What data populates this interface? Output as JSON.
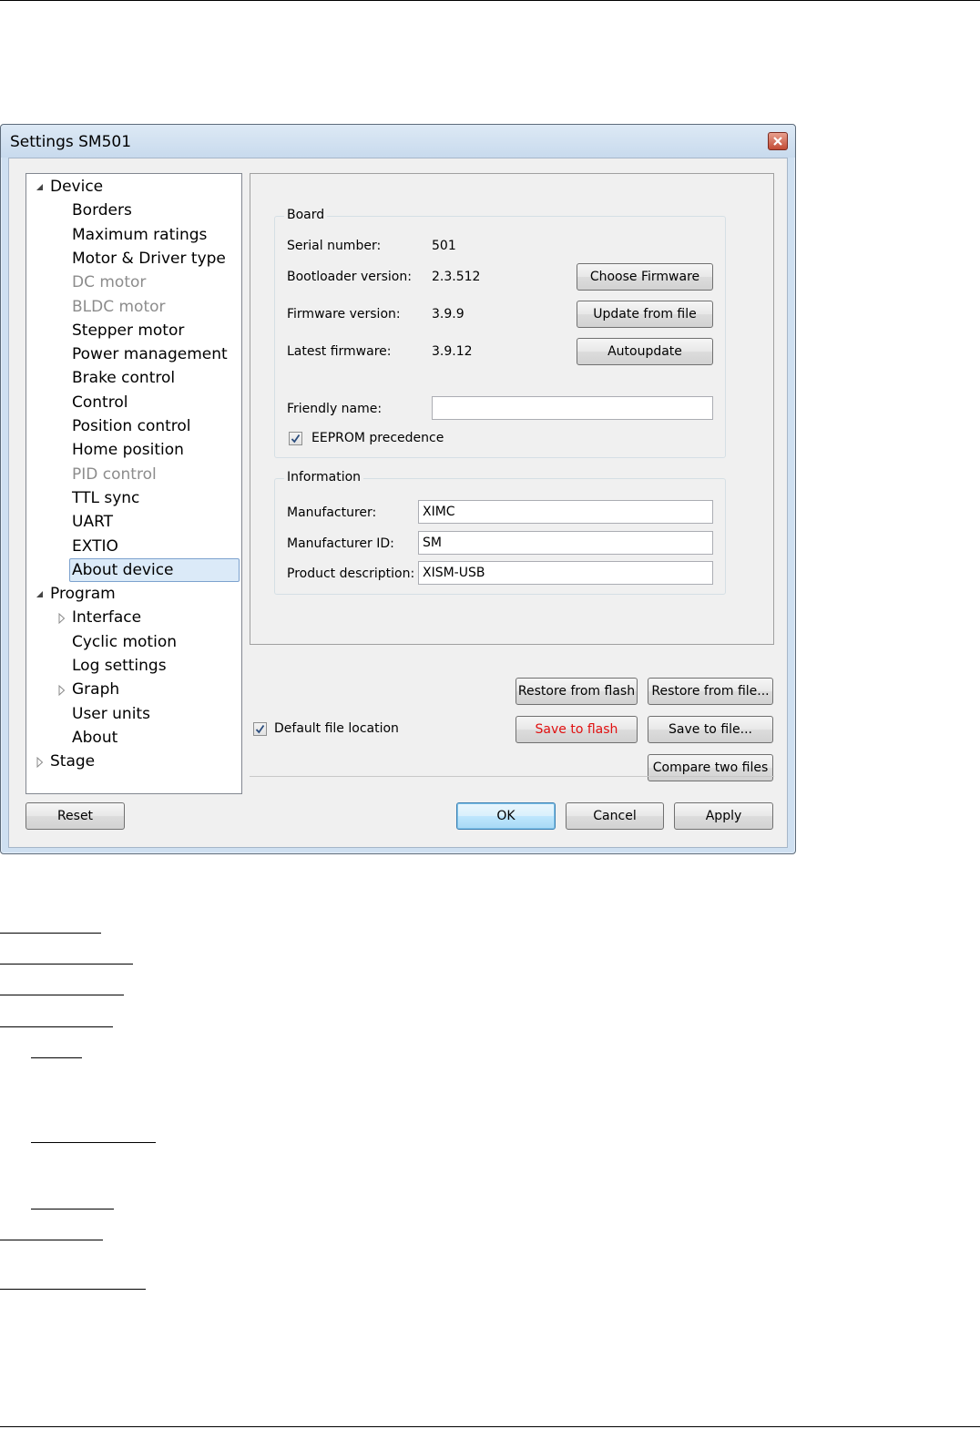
{
  "window": {
    "title": "Settings SM501"
  },
  "tree": {
    "items": [
      {
        "label": "Device",
        "level": 0,
        "expander": "expanded",
        "disabled": false,
        "selected": false
      },
      {
        "label": "Borders",
        "level": 1,
        "expander": "none",
        "disabled": false,
        "selected": false
      },
      {
        "label": "Maximum ratings",
        "level": 1,
        "expander": "none",
        "disabled": false,
        "selected": false
      },
      {
        "label": "Motor & Driver type",
        "level": 1,
        "expander": "none",
        "disabled": false,
        "selected": false
      },
      {
        "label": "DC motor",
        "level": 1,
        "expander": "none",
        "disabled": true,
        "selected": false
      },
      {
        "label": "BLDC motor",
        "level": 1,
        "expander": "none",
        "disabled": true,
        "selected": false
      },
      {
        "label": "Stepper motor",
        "level": 1,
        "expander": "none",
        "disabled": false,
        "selected": false
      },
      {
        "label": "Power management",
        "level": 1,
        "expander": "none",
        "disabled": false,
        "selected": false
      },
      {
        "label": "Brake control",
        "level": 1,
        "expander": "none",
        "disabled": false,
        "selected": false
      },
      {
        "label": "Control",
        "level": 1,
        "expander": "none",
        "disabled": false,
        "selected": false
      },
      {
        "label": "Position control",
        "level": 1,
        "expander": "none",
        "disabled": false,
        "selected": false
      },
      {
        "label": "Home position",
        "level": 1,
        "expander": "none",
        "disabled": false,
        "selected": false
      },
      {
        "label": "PID control",
        "level": 1,
        "expander": "none",
        "disabled": true,
        "selected": false
      },
      {
        "label": "TTL sync",
        "level": 1,
        "expander": "none",
        "disabled": false,
        "selected": false
      },
      {
        "label": "UART",
        "level": 1,
        "expander": "none",
        "disabled": false,
        "selected": false
      },
      {
        "label": "EXTIO",
        "level": 1,
        "expander": "none",
        "disabled": false,
        "selected": false
      },
      {
        "label": "About device",
        "level": 1,
        "expander": "none",
        "disabled": false,
        "selected": true
      },
      {
        "label": "Program",
        "level": 0,
        "expander": "expanded",
        "disabled": false,
        "selected": false
      },
      {
        "label": "Interface",
        "level": 1,
        "expander": "collapsed",
        "disabled": false,
        "selected": false
      },
      {
        "label": "Cyclic motion",
        "level": 1,
        "expander": "none",
        "disabled": false,
        "selected": false
      },
      {
        "label": "Log settings",
        "level": 1,
        "expander": "none",
        "disabled": false,
        "selected": false
      },
      {
        "label": "Graph",
        "level": 1,
        "expander": "collapsed",
        "disabled": false,
        "selected": false
      },
      {
        "label": "User units",
        "level": 1,
        "expander": "none",
        "disabled": false,
        "selected": false
      },
      {
        "label": "About",
        "level": 1,
        "expander": "none",
        "disabled": false,
        "selected": false
      },
      {
        "label": "Stage",
        "level": 0,
        "expander": "collapsed",
        "disabled": false,
        "selected": false
      }
    ]
  },
  "board": {
    "title": "Board",
    "serial_label": "Serial number:",
    "serial_value": "501",
    "bootloader_label": "Bootloader version:",
    "bootloader_value": "2.3.512",
    "firmware_label": "Firmware version:",
    "firmware_value": "3.9.9",
    "latest_label": "Latest firmware:",
    "latest_value": "3.9.12",
    "choose_firmware": "Choose Firmware",
    "update_from_file": "Update from file",
    "autoupdate": "Autoupdate",
    "friendly_label": "Friendly name:",
    "friendly_value": "",
    "eeprom_label": "EEPROM precedence",
    "eeprom_checked": true
  },
  "information": {
    "title": "Information",
    "manufacturer_label": "Manufacturer:",
    "manufacturer_value": "XIMC",
    "manufacturer_id_label": "Manufacturer ID:",
    "manufacturer_id_value": "SM",
    "product_label": "Product description:",
    "product_value": "XISM-USB"
  },
  "actions": {
    "restore_flash": "Restore from flash",
    "restore_file": "Restore from file...",
    "save_flash": "Save to flash",
    "save_file": "Save to file...",
    "compare": "Compare two files",
    "default_location_label": "Default file location",
    "default_location_checked": true
  },
  "footer": {
    "reset": "Reset",
    "ok": "OK",
    "cancel": "Cancel",
    "apply": "Apply"
  },
  "colors": {
    "red_text": "#e01010",
    "tree_disabled": "#8c8c8c",
    "selection": "#dbeaf8"
  }
}
